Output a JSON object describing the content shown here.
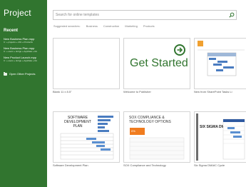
{
  "sidebar": {
    "app_title": "Project",
    "recent_heading": "Recent",
    "recent": [
      {
        "name": "New Business Plan.mpp",
        "path": "C: » projects » 201 » Productiv"
      },
      {
        "name": "New Business Plan.mpp",
        "path": "C: » users » skrtge » AppData » Ro"
      },
      {
        "name": "New Product Launch.mpp",
        "path": "C: » users » skrtge » AppData » Ro"
      }
    ],
    "open_other": "Open Other Projects"
  },
  "search": {
    "placeholder": "Search for online templates"
  },
  "suggestions": {
    "label": "Suggested searches:",
    "items": [
      "Business",
      "Construction",
      "Marketing",
      "Products"
    ]
  },
  "templates": [
    {
      "label": "Blank 11 x 8.5\""
    },
    {
      "label": "Welcome to Publisher",
      "art": "Get Started"
    },
    {
      "label": "New from SharePoint Tasks Li"
    },
    {
      "label": "Software Development Plan",
      "art": "SOFTWARE DEVELOPMENT PLAN"
    },
    {
      "label": "SOX Compliance and Technology",
      "art": "SOX COMPLIANCE & TECHNOLOGY OPTIONS",
      "art_badge": "0%"
    },
    {
      "label": "Six Sigma DMAIC Cycle",
      "art": "SIX SIGMA DMAIC CYCLE"
    }
  ],
  "colors": {
    "brand": "#31752f",
    "accent_orange": "#f07c1f"
  }
}
